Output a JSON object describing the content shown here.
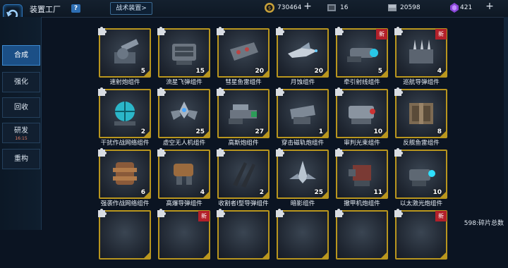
{
  "header": {
    "title": "装置工厂",
    "help_label": "?",
    "tech_button": "战术装置>",
    "resources": [
      {
        "icon": "coin-icon",
        "value": "730464"
      },
      {
        "icon": "chip-icon",
        "value": "16"
      },
      {
        "icon": "alloy-icon",
        "value": "20598"
      },
      {
        "icon": "crystal-icon",
        "value": "421"
      }
    ],
    "plus": "+"
  },
  "sidebar": {
    "items": [
      {
        "label": "合成",
        "active": true
      },
      {
        "label": "强化"
      },
      {
        "label": "回收"
      },
      {
        "label": "研发",
        "sub": "16:15"
      },
      {
        "label": "重构"
      }
    ]
  },
  "cards": [
    {
      "name": "速射炮组件",
      "count": "5",
      "new": false,
      "art": "turret"
    },
    {
      "name": "流星飞弹组件",
      "count": "15",
      "new": false,
      "art": "launcher"
    },
    {
      "name": "彗星鱼雷组件",
      "count": "20",
      "new": false,
      "art": "torpedo"
    },
    {
      "name": "月蚀组件",
      "count": "20",
      "new": false,
      "art": "ship"
    },
    {
      "name": "牵引射线组件",
      "count": "5",
      "new": true,
      "art": "beam"
    },
    {
      "name": "巡航导弹组件",
      "count": "4",
      "new": true,
      "art": "missile"
    },
    {
      "name": "干扰作战网络组件",
      "count": "2",
      "new": false,
      "art": "globe"
    },
    {
      "name": "虚空无人机组件",
      "count": "25",
      "new": false,
      "art": "drone"
    },
    {
      "name": "高斯炮组件",
      "count": "27",
      "new": false,
      "art": "gauss"
    },
    {
      "name": "穿击磁轨炮组件",
      "count": "1",
      "new": false,
      "art": "rail"
    },
    {
      "name": "审判光束组件",
      "count": "10",
      "new": false,
      "art": "beam2"
    },
    {
      "name": "反舰鱼雷组件",
      "count": "8",
      "new": false,
      "art": "crate"
    },
    {
      "name": "强袭作战网络组件",
      "count": "6",
      "new": false,
      "art": "tower"
    },
    {
      "name": "高爆导弹组件",
      "count": "4",
      "new": false,
      "art": "mech"
    },
    {
      "name": "收割者I型导弹组件",
      "count": "2",
      "new": false,
      "art": "claw"
    },
    {
      "name": "暗影组件",
      "count": "25",
      "new": false,
      "art": "fighter"
    },
    {
      "name": "撤甲机炮组件",
      "count": "11",
      "new": false,
      "art": "cannon"
    },
    {
      "name": "以太激光炮组件",
      "count": "10",
      "new": false,
      "art": "laser"
    }
  ],
  "partial_row_new": [
    false,
    true,
    false,
    false,
    false,
    true
  ],
  "footer": "598:碎片总数",
  "colors": {
    "accent": "#2d6eb3",
    "frame": "#b9961e",
    "new": "#b3202a"
  }
}
